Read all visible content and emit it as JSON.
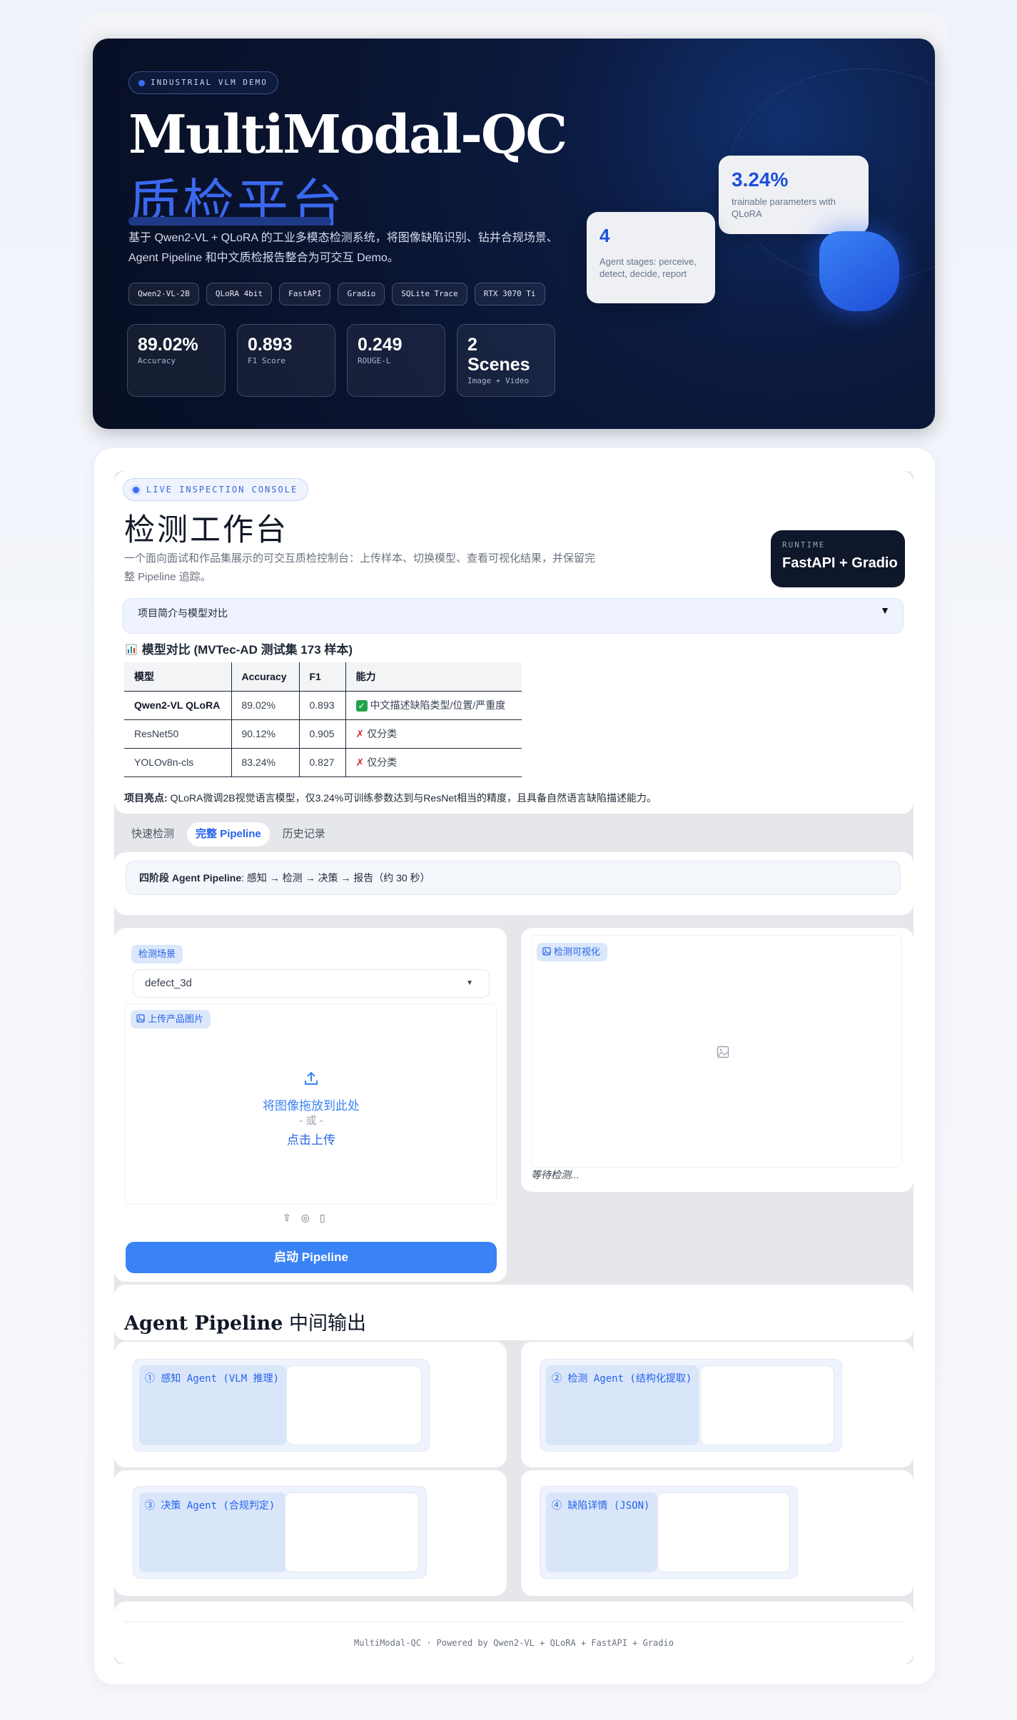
{
  "hero": {
    "tag": "INDUSTRIAL VLM DEMO",
    "title": "MultiModal-QC",
    "subtitle": "质检平台",
    "description": "基于 Qwen2-VL + QLoRA 的工业多模态检测系统，将图像缺陷识别、钻井合规场景、Agent Pipeline 和中文质检报告整合为可交互 Demo。",
    "tech": [
      "Qwen2-VL-2B",
      "QLoRA 4bit",
      "FastAPI",
      "Gradio",
      "SQLite Trace",
      "RTX 3070 Ti"
    ],
    "metrics": [
      {
        "value": "89.02%",
        "label": "Accuracy"
      },
      {
        "value": "0.893",
        "label": "F1 Score"
      },
      {
        "value": "0.249",
        "label": "ROUGE-L"
      },
      {
        "value": "2 Scenes",
        "label": "Image + Video"
      }
    ],
    "card_params": {
      "value": "3.24%",
      "label": "trainable parameters with QLoRA"
    },
    "card_stages": {
      "value": "4",
      "label": "Agent stages: perceive, detect, decide, report"
    }
  },
  "console": {
    "pill": "LIVE INSPECTION CONSOLE",
    "title": "检测工作台",
    "description": "一个面向面试和作品集展示的可交互质检控制台：上传样本、切换模型、查看可视化结果，并保留完整 Pipeline 追踪。",
    "runtime_label": "RUNTIME",
    "runtime_value": "FastAPI + Gradio",
    "details_summary": "项目简介与模型对比",
    "details_arrow": "▼",
    "comparison_title": "模型对比 (MVTec-AD 测试集 173 样本)",
    "comparison_icon": "bar-chart-icon",
    "table_headers": [
      "模型",
      "Accuracy",
      "F1",
      "能力"
    ],
    "table_rows": [
      {
        "model": "Qwen2-VL QLoRA",
        "acc": "89.02%",
        "f1": "0.893",
        "ability": "中文描述缺陷类型/位置/严重度",
        "mark": "✓"
      },
      {
        "model": "ResNet50",
        "acc": "90.12%",
        "f1": "0.905",
        "ability": "仅分类",
        "mark": "✗"
      },
      {
        "model": "YOLOv8n-cls",
        "acc": "83.24%",
        "f1": "0.827",
        "ability": "仅分类",
        "mark": "✗"
      }
    ],
    "highlight_label": "项目亮点:",
    "highlight_text": "QLoRA微调2B视觉语言模型，仅3.24%可训练参数达到与ResNet相当的精度，且具备自然语言缺陷描述能力。",
    "tabs": [
      "快速检测",
      "完整 Pipeline",
      "历史记录"
    ],
    "active_tab": "完整 Pipeline",
    "stage_label": "四阶段 Agent Pipeline",
    "stage_text": ": 感知 → 检测 → 决策 → 报告（约 30 秒）",
    "scene_label": "检测场景",
    "scene_value": "defect_3d",
    "upload_label": "上传产品图片",
    "upload_drop": "将图像拖放到此处",
    "upload_or": "- 或 -",
    "upload_click": "点击上传",
    "run_button": "启动 Pipeline",
    "viz_label": "检测可视化",
    "viz_status": "等待检测...",
    "agent_title_en": "Agent Pipeline",
    "agent_title_cn": "中间输出",
    "agents": [
      "① 感知 Agent (VLM 推理)",
      "② 检测 Agent (结构化提取)",
      "③ 决策 Agent (合规判定)",
      "④ 缺陷详情 (JSON)"
    ],
    "footer": "MultiModal-QC · Powered by Qwen2-VL + QLoRA + FastAPI + Gradio"
  },
  "colors": {
    "accent": "#3b82f6",
    "hero_bg": "#0a1430",
    "primary_text": "#2563eb"
  }
}
